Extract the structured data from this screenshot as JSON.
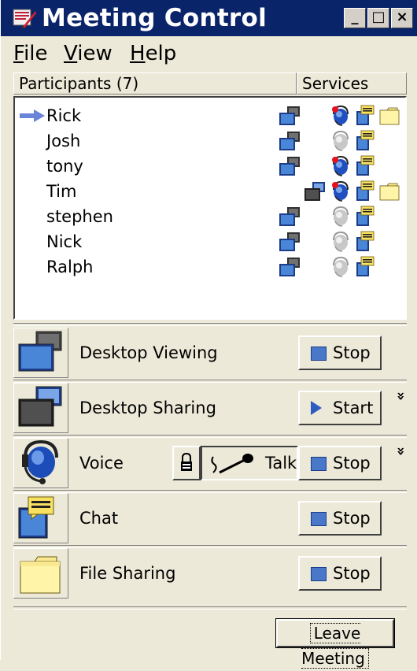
{
  "window": {
    "title": "Meeting Control",
    "controls": [
      "_",
      "□",
      "×"
    ]
  },
  "menu": {
    "items": [
      {
        "label": "File",
        "accel": "F",
        "rest": "ile"
      },
      {
        "label": "View",
        "accel": "V",
        "rest": "iew"
      },
      {
        "label": "Help",
        "accel": "H",
        "rest": "elp"
      }
    ]
  },
  "columns": {
    "participants": "Participants (7)",
    "services": "Services"
  },
  "participants": [
    {
      "name": "Rick",
      "current": true,
      "desktop_sharing": false,
      "voice_active": true,
      "chat": true,
      "files": true
    },
    {
      "name": "Josh",
      "current": false,
      "desktop_sharing": false,
      "voice_active": false,
      "chat": true,
      "files": false
    },
    {
      "name": "tony",
      "current": false,
      "desktop_sharing": false,
      "voice_active": true,
      "chat": true,
      "files": false
    },
    {
      "name": "Tim",
      "current": false,
      "desktop_sharing": true,
      "voice_active": true,
      "chat": true,
      "files": true
    },
    {
      "name": "stephen",
      "current": false,
      "desktop_sharing": false,
      "voice_active": false,
      "chat": true,
      "files": false
    },
    {
      "name": "Nick",
      "current": false,
      "desktop_sharing": false,
      "voice_active": false,
      "chat": true,
      "files": false
    },
    {
      "name": "Ralph",
      "current": false,
      "desktop_sharing": false,
      "voice_active": false,
      "chat": true,
      "files": false
    }
  ],
  "services": {
    "desktop_viewing": {
      "label": "Desktop Viewing",
      "button": "Stop"
    },
    "desktop_sharing": {
      "label": "Desktop Sharing",
      "button": "Start",
      "expander": "»"
    },
    "voice": {
      "label": "Voice",
      "talk": "Talk",
      "button": "Stop",
      "expander": "»"
    },
    "chat": {
      "label": "Chat",
      "button": "Stop"
    },
    "file_sharing": {
      "label": "File Sharing",
      "button": "Stop"
    }
  },
  "footer": {
    "leave": "Leave Meeting"
  },
  "icons": {
    "app": "meeting-logo-icon",
    "monitor": "monitor-icon",
    "headset": "headset-icon",
    "chat": "chat-icon",
    "folder": "folder-icon",
    "lock": "lock-icon",
    "microphone": "microphone-icon"
  },
  "colors": {
    "titlebar": "#0a246a",
    "window": "#ece9d8",
    "stop_square": "#4a78c8",
    "arrow": "#6a84d8",
    "voice_active_dot": "#e8101c"
  }
}
